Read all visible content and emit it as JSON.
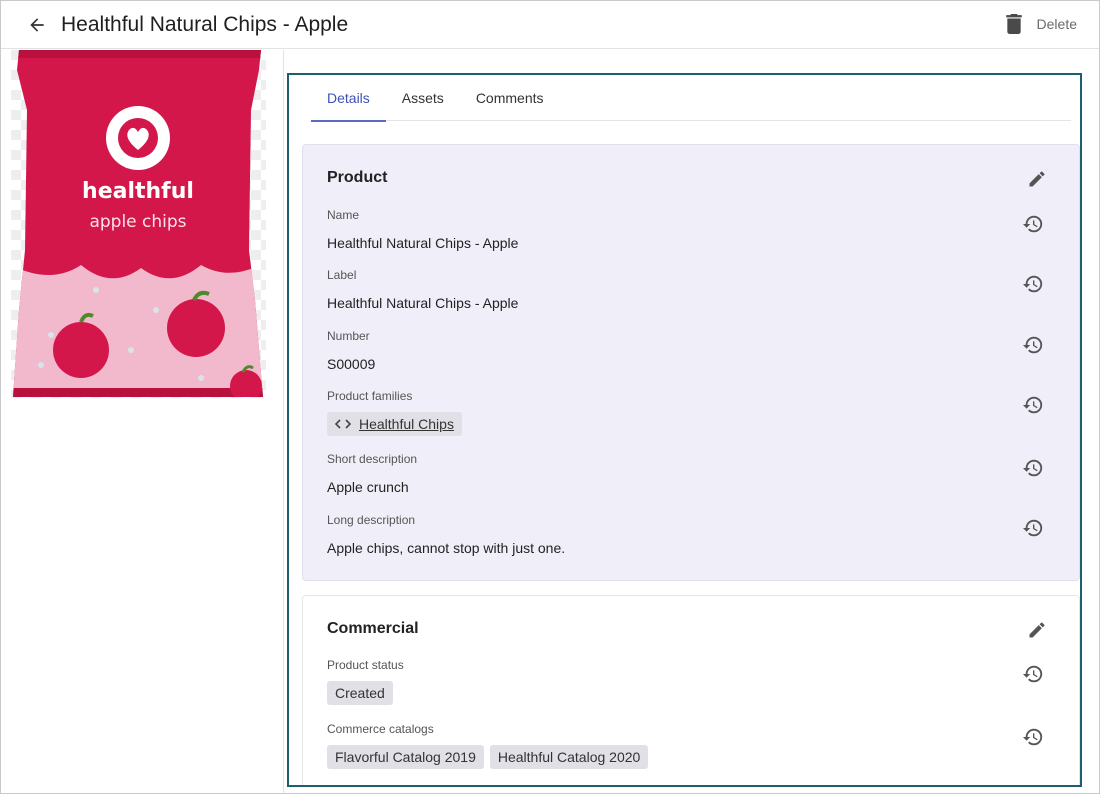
{
  "header": {
    "title": "Healthful Natural Chips - Apple",
    "delete_label": "Delete"
  },
  "image": {
    "brand": "healthful",
    "subtitle": "apple chips",
    "bag_color": "#d4174a",
    "lower_color": "#f2b8cb"
  },
  "tabs": [
    {
      "label": "Details",
      "active": true
    },
    {
      "label": "Assets",
      "active": false
    },
    {
      "label": "Comments",
      "active": false
    }
  ],
  "product_section": {
    "title": "Product",
    "fields": [
      {
        "label": "Name",
        "value": "Healthful Natural Chips - Apple"
      },
      {
        "label": "Label",
        "value": "Healthful Natural Chips - Apple"
      },
      {
        "label": "Number",
        "value": "S00009"
      },
      {
        "label": "Product families",
        "chip": "Healthful Chips"
      },
      {
        "label": "Short description",
        "value": "Apple crunch"
      },
      {
        "label": "Long description",
        "value": "Apple chips, cannot stop with just one."
      }
    ]
  },
  "commercial_section": {
    "title": "Commercial",
    "fields": [
      {
        "label": "Product status",
        "chips": [
          "Created"
        ]
      },
      {
        "label": "Commerce catalogs",
        "chips": [
          "Flavorful Catalog 2019",
          "Healthful Catalog 2020"
        ]
      }
    ]
  },
  "colors": {
    "accent": "#3f51b5",
    "focus_border": "#1d5f6e",
    "product_card_bg": "#f0eff9"
  }
}
